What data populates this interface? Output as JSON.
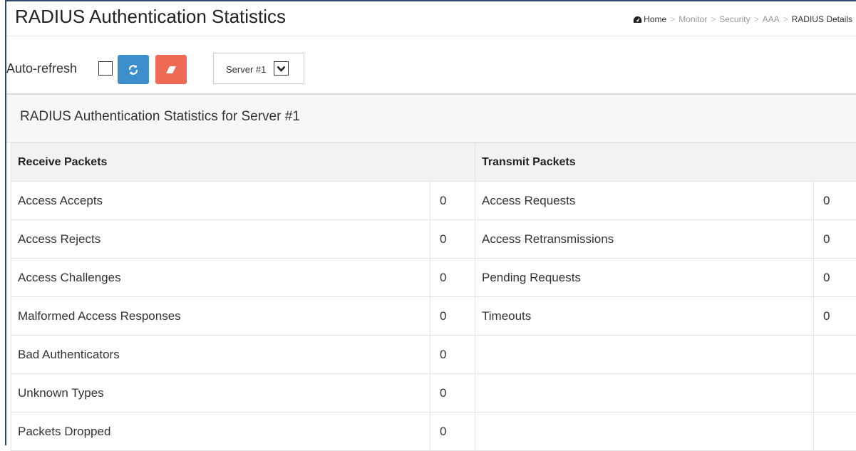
{
  "header": {
    "title": "RADIUS Authentication Statistics",
    "breadcrumb": [
      {
        "label": "Home",
        "icon": "dashboard-icon"
      },
      {
        "label": "Monitor"
      },
      {
        "label": "Security"
      },
      {
        "label": "AAA"
      },
      {
        "label": "RADIUS Details"
      }
    ]
  },
  "toolbar": {
    "auto_refresh_label": "Auto-refresh",
    "auto_refresh_checked": false,
    "refresh_button_icon": "refresh-icon",
    "clear_button_icon": "eraser-icon",
    "server_select_value": "Server #1"
  },
  "colors": {
    "refresh_button": "#3d8fcb",
    "clear_button": "#ef6a55",
    "frame": "#2d4a6b"
  },
  "panel": {
    "title": "RADIUS Authentication Statistics for Server #1"
  },
  "table": {
    "receive_header": "Receive Packets",
    "transmit_header": "Transmit Packets",
    "rows": [
      {
        "rx_label": "Access Accepts",
        "rx_value": "0",
        "tx_label": "Access Requests",
        "tx_value": "0"
      },
      {
        "rx_label": "Access Rejects",
        "rx_value": "0",
        "tx_label": "Access Retransmissions",
        "tx_value": "0"
      },
      {
        "rx_label": "Access Challenges",
        "rx_value": "0",
        "tx_label": "Pending Requests",
        "tx_value": "0"
      },
      {
        "rx_label": "Malformed Access Responses",
        "rx_value": "0",
        "tx_label": "Timeouts",
        "tx_value": "0"
      },
      {
        "rx_label": "Bad Authenticators",
        "rx_value": "0",
        "tx_label": "",
        "tx_value": ""
      },
      {
        "rx_label": "Unknown Types",
        "rx_value": "0",
        "tx_label": "",
        "tx_value": ""
      },
      {
        "rx_label": "Packets Dropped",
        "rx_value": "0",
        "tx_label": "",
        "tx_value": ""
      }
    ]
  }
}
